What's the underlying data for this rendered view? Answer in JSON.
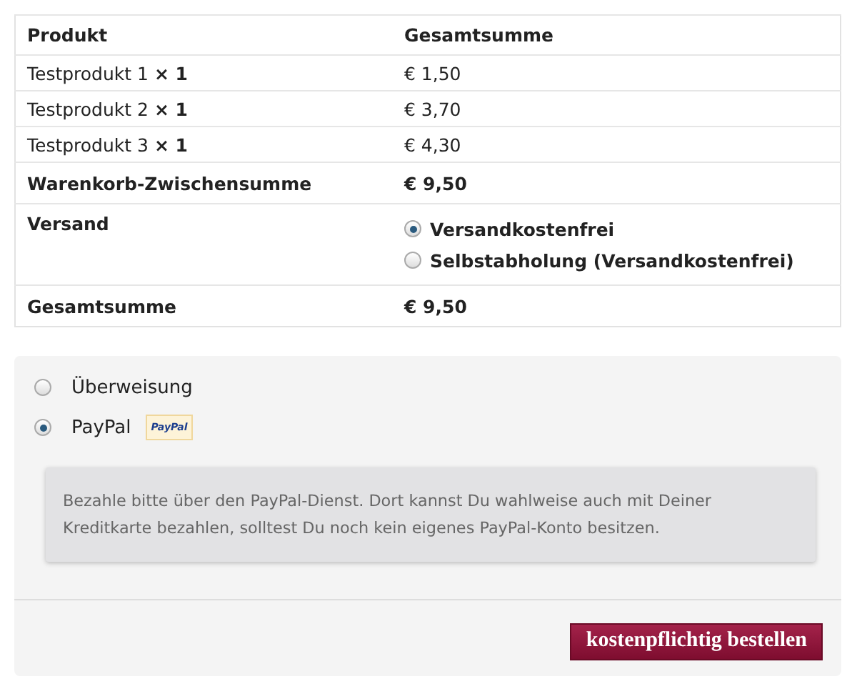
{
  "order_table": {
    "columns": [
      "Produkt",
      "Gesamtsumme"
    ],
    "items": [
      {
        "product": "Testprodukt 1 **× 1**",
        "total": "€ 1,50"
      },
      {
        "product": "Testprodukt 2 **× 1**",
        "total": "€ 3,70"
      },
      {
        "product": "Testprodukt 3 **× 1**",
        "total": "€ 4,30"
      }
    ],
    "subtotal": {
      "label": "Warenkorb-Zwischensumme",
      "value": "€ 9,50"
    },
    "shipping": {
      "label": "Versand",
      "options": [
        {
          "label": "Versandkostenfrei",
          "selected": true
        },
        {
          "label": "Selbstabholung (Versandkostenfrei)",
          "selected": false
        }
      ]
    },
    "total": {
      "label": "Gesamtsumme",
      "value": "€ 9,50"
    }
  },
  "payment": {
    "methods": [
      {
        "label": "Überweisung",
        "selected": false
      },
      {
        "label": "PayPal",
        "selected": true,
        "logo_text": "PayPal"
      }
    ],
    "description": "Bezahle bitte über den PayPal-Dienst. Dort kannst Du wahlweise auch mit Deiner Kreditkarte bezahlen, solltest Du noch kein eigenes PayPal-Konto besitzen.",
    "submit_button": "kostenpflichtig bestellen"
  }
}
